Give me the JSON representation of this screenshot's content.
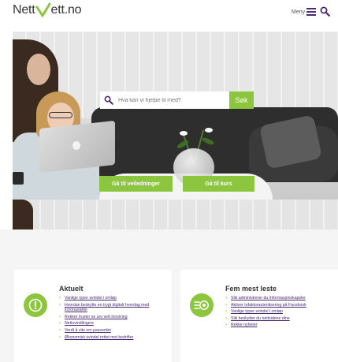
{
  "header": {
    "logo_prefix": "Nett",
    "logo_v": "V",
    "logo_suffix": "ett.no",
    "menu_label": "Meny"
  },
  "search": {
    "placeholder": "Hva kan vi hjelpe til med?",
    "button_label": "Søk"
  },
  "hero_buttons": {
    "guides_label": "Gå til veiledninger",
    "courses_label": "Gå til kurs"
  },
  "cards": {
    "aktuelt": {
      "title": "Aktuelt",
      "items": [
        "Vanlige typer svindel i omløp",
        "Hvordan beskytte en trygt digitalt hverdag med koronastøtte",
        "Rekker trusler av uro vett innsiving",
        "Nettsvindlingers",
        "Verdt å vite om passordet",
        "Økonomisk svindel rettet mot bedrifter"
      ]
    },
    "fem_mest_leste": {
      "title": "Fem mest leste",
      "items": [
        "Slik administrerer du informasjonskapsler",
        "Aktiver tofaktorautentisering på Facebook",
        "Vanlige typer svindel i omløp",
        "Slik beskytter du nettsidene dine",
        "Rekke nyheter"
      ]
    }
  },
  "colors": {
    "accent_green": "#8cc63f",
    "brand_purple": "#4b2a73"
  },
  "icons": {
    "menu": "hamburger-icon",
    "search": "magnifier-icon",
    "aktuelt": "exclamation-circle-icon",
    "fem_mest_leste": "list-star-icon"
  }
}
